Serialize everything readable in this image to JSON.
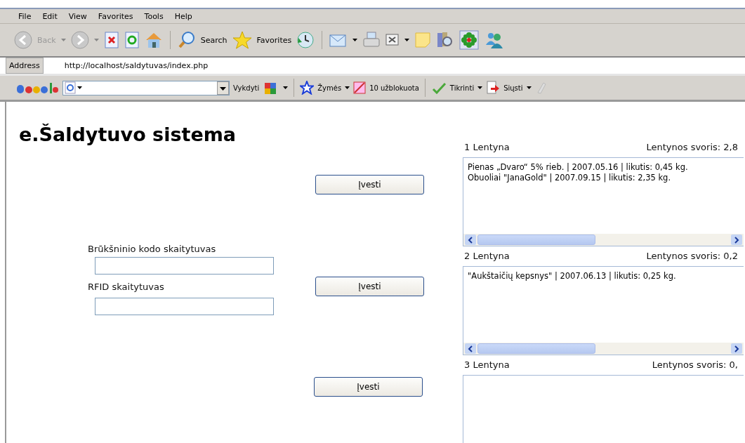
{
  "menu": [
    "File",
    "Edit",
    "View",
    "Favorites",
    "Tools",
    "Help"
  ],
  "toolbar": {
    "back": "Back",
    "search": "Search",
    "favorites": "Favorites"
  },
  "address": {
    "label": "Address",
    "value": "http://localhost/saldytuvas/index.php"
  },
  "google_bar": {
    "go": "Vykdyti",
    "bookmarks": "Žymės",
    "blocked": "10 užblokuota",
    "check": "Tikrinti",
    "send": "Siųsti"
  },
  "page": {
    "title": "e.Šaldytuvo sistema",
    "buttons": [
      "Įvesti",
      "Įvesti",
      "Įvesti"
    ],
    "fields": [
      {
        "label": "Brūkšninio kodo skaitytuvas"
      },
      {
        "label": "RFID skaitytuvas"
      }
    ]
  },
  "shelves": [
    {
      "name": "1 Lentyna",
      "weight": "Lentynos svoris: 2,8",
      "items": [
        "Pienas „Dvaro“ 5% rieb. | 2007.05.16 | likutis: 0,45 kg.",
        "Obuoliai \"JanaGold\" | 2007.09.15 | likutis: 2,35 kg."
      ]
    },
    {
      "name": "2 Lentyna",
      "weight": "Lentynos svoris: 0,2",
      "items": [
        "\"Aukštaičių kepsnys\" | 2007.06.13 | likutis: 0,25 kg."
      ]
    },
    {
      "name": "3 Lentyna",
      "weight": "Lentynos svoris: 0,"
    }
  ]
}
